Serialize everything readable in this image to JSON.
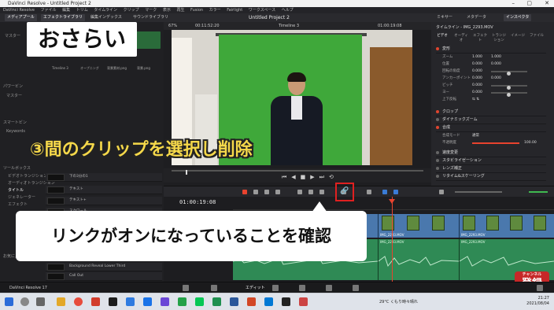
{
  "titlebar": {
    "title": "DaVinci Resolve - Untitled Project 2"
  },
  "menu": [
    "DaVinci Resolve",
    "ファイル",
    "編集",
    "トリム",
    "タイムライン",
    "クリップ",
    "マーク",
    "表示",
    "再生",
    "Fusion",
    "カラー",
    "Fairlight",
    "ワークスペース",
    "ヘルプ"
  ],
  "toolbar": {
    "media_pool": "メディアプール",
    "effects": "エフェクトライブラリ",
    "edit_index": "編集インデックス",
    "sound_library": "サウンドライブラリ",
    "project_title": "Untitled Project 2",
    "mixer": "ミキサー",
    "metadata": "メタデータ",
    "inspector": "インスペクタ"
  },
  "viewer": {
    "zoom": "67%",
    "source_tc": "00:11:52:20",
    "timeline_name": "Timeline 3",
    "clip_tc": "01:00:19:08",
    "clip_name": "IMG_2293.MOV"
  },
  "left_panel": {
    "master": "マスター",
    "thumbs": [
      "Timeline 3",
      "オープニング",
      "背景素材.png",
      "背景.png"
    ],
    "power_bins": "パワービン",
    "smart_bins": "スマートビン",
    "keywords": "Keywords",
    "toolbox": "ツールボックス",
    "fx_list": [
      "ビデオトランジション",
      "オーディオトランジション",
      "タイトル",
      "ジェネレーター",
      "エフェクト"
    ],
    "fx_items": [
      "下の3分の1",
      "テキスト",
      "テキスト+",
      "スクロール"
    ],
    "bottom_items": [
      "Background Reveal Lower Third",
      "Call Out"
    ],
    "favorites": "お気に入り"
  },
  "inspector": {
    "clip": "タイムライン - IMG_2293.MOV",
    "tabs": [
      "ビデオ",
      "オーディオ",
      "エフェクト",
      "トランジション",
      "イメージ",
      "ファイル"
    ],
    "sections": [
      "変形",
      "クロップ",
      "ダイナミックズーム",
      "合成",
      "速度変更",
      "スタビライゼーション",
      "レンズ補正",
      "リタイム&スケーリング"
    ],
    "rows": [
      {
        "label": "ズーム",
        "x": "1.000",
        "y": "1.000"
      },
      {
        "label": "位置",
        "x": "0.000",
        "y": "0.000"
      },
      {
        "label": "回転の角度",
        "x": "0.000"
      },
      {
        "label": "アンカーポイント",
        "x": "0.000",
        "y": "0.000"
      },
      {
        "label": "ピッチ",
        "x": "0.000"
      },
      {
        "label": "ヨー",
        "x": "0.000"
      },
      {
        "label": "上下反転",
        "x": ""
      }
    ],
    "composite_mode_label": "合成モード",
    "composite_mode": "通常",
    "opacity_label": "不透明度",
    "opacity": "100.00"
  },
  "timeline": {
    "timecode": "01:00:19:08",
    "video_clips": [
      "IMG_2293.MOV",
      "IMG_2293.MOV",
      "IMG_2293.MOV"
    ],
    "audio_clips": [
      "IMG_2293.MOV",
      "IMG_2293.MOV",
      "IMG_2293.MOV"
    ]
  },
  "overlays": {
    "review": "おさらい",
    "step": "③間のクリップを選択し削除",
    "bubble": "リンクがオンになっていることを確認"
  },
  "badge": {
    "top": "チャンネル",
    "main": "登録"
  },
  "resolve_bottom": {
    "app": "DaVinci Resolve 17",
    "page": "エディット"
  },
  "taskbar": {
    "weather": "29°C くもり時々晴れ",
    "time": "21:27",
    "date": "2021/08/04"
  },
  "colors": {
    "accent_red": "#e8432e",
    "video_clip": "#4a78ad",
    "audio_clip": "#2f8a55",
    "step_text": "#f5d84a"
  }
}
